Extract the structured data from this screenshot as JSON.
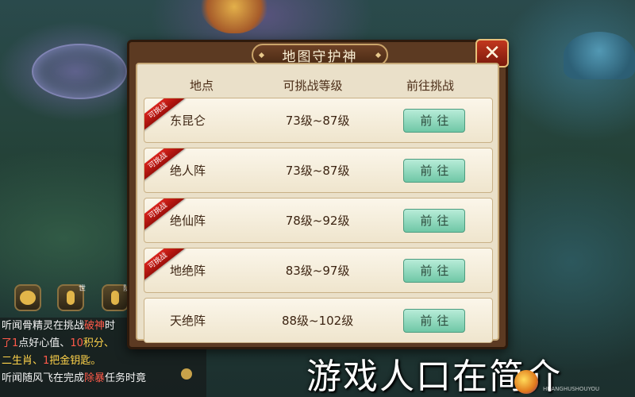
{
  "dialog": {
    "title": "地图守护神",
    "close_label": "✕",
    "columns": [
      "地点",
      "可挑战等级",
      "前往挑战"
    ],
    "rows": [
      {
        "name": "东昆仑",
        "level": "73级~87级",
        "badge": "可挑战",
        "action": "前往"
      },
      {
        "name": "绝人阵",
        "level": "73级~87级",
        "badge": "可挑战",
        "action": "前往"
      },
      {
        "name": "绝仙阵",
        "level": "78级~92级",
        "badge": "可挑战",
        "action": "前往"
      },
      {
        "name": "地绝阵",
        "level": "83级~97级",
        "badge": "可挑战",
        "action": "前往"
      },
      {
        "name": "天绝阵",
        "level": "88级~102级",
        "badge": "",
        "action": "前往"
      }
    ]
  },
  "chat": {
    "voice_tags": [
      "世",
      "队"
    ],
    "lines": [
      {
        "a": "听闻骨精灵在挑战",
        "b": "破神",
        "c": "时"
      },
      {
        "a": "了",
        "b": "1",
        "c": "点好心值、",
        "d": "10",
        "e": "积分、"
      },
      {
        "a": "二生肖、",
        "b": "1",
        "c": "把金钥匙。"
      },
      {
        "a": "听闻随风飞在完成",
        "b": "除暴",
        "c": "任务时竟"
      }
    ]
  },
  "caption": "游戏人口在简介",
  "watermark": "HUANGHUSHOUYOU"
}
